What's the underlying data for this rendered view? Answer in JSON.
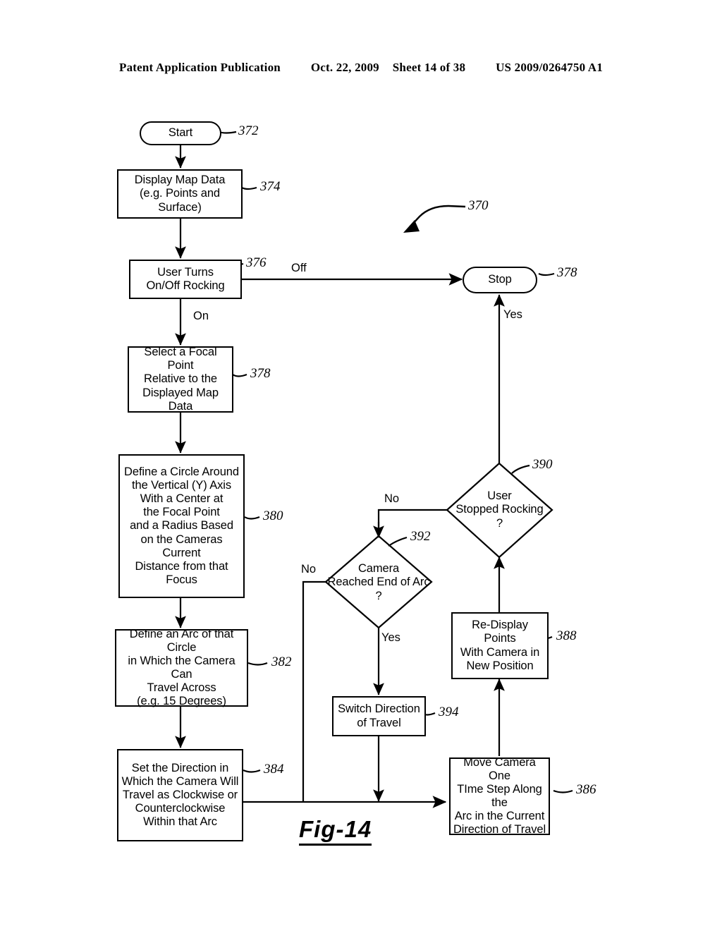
{
  "header": {
    "publication": "Patent Application Publication",
    "date": "Oct. 22, 2009",
    "sheet": "Sheet 14 of 38",
    "pub_number": "US 2009/0264750 A1"
  },
  "figure": {
    "caption": "Fig-14",
    "diagram_ref": "370",
    "nodes": [
      {
        "id": "start",
        "ref": "372",
        "type": "terminator",
        "text": "Start"
      },
      {
        "id": "display_map",
        "ref": "374",
        "type": "process",
        "text": "Display Map Data\n(e.g. Points and Surface)"
      },
      {
        "id": "toggle_rock",
        "ref": "376",
        "type": "process",
        "text": "User Turns\nOn/Off Rocking"
      },
      {
        "id": "stop",
        "ref": "378",
        "type": "terminator",
        "text": "Stop"
      },
      {
        "id": "focal_point",
        "ref": "378",
        "type": "process",
        "text": "Select a Focal Point\nRelative to the\nDisplayed Map Data"
      },
      {
        "id": "define_circle",
        "ref": "380",
        "type": "process",
        "text": "Define a Circle Around\nthe Vertical (Y) Axis\nWith a Center at\nthe Focal Point\nand a Radius Based\non the Cameras Current\nDistance from that Focus"
      },
      {
        "id": "define_arc",
        "ref": "382",
        "type": "process",
        "text": "Define an Arc of that Circle\nin Which the Camera Can\nTravel Across\n(e.g. 15 Degrees)"
      },
      {
        "id": "set_direction",
        "ref": "384",
        "type": "process",
        "text": "Set the Direction in\nWhich the Camera Will\nTravel as Clockwise or\nCounterclockwise\nWithin that Arc"
      },
      {
        "id": "move_camera",
        "ref": "386",
        "type": "process",
        "text": "Move Camera One\nTIme Step Along the\nArc in the Current\nDirection of Travel"
      },
      {
        "id": "redisplay",
        "ref": "388",
        "type": "process",
        "text": "Re-Display Points\nWith Camera in\nNew Position"
      },
      {
        "id": "user_stopped",
        "ref": "390",
        "type": "decision",
        "text": "User\nStopped Rocking\n?"
      },
      {
        "id": "end_of_arc",
        "ref": "392",
        "type": "decision",
        "text": "Camera\nReached End of Arc\n?"
      },
      {
        "id": "switch_dir",
        "ref": "394",
        "type": "process",
        "text": "Switch Direction\nof Travel"
      }
    ],
    "edge_labels": {
      "off": "Off",
      "on": "On",
      "yes_to_stop": "Yes",
      "no_from_user_stopped": "No",
      "no_from_end_of_arc": "No",
      "yes_from_end_of_arc": "Yes"
    },
    "node_text": {
      "start": "Start",
      "display_map_l1": "Display Map Data",
      "display_map_l2": "(e.g. Points and Surface)",
      "toggle_rock_l1": "User Turns",
      "toggle_rock_l2": "On/Off Rocking",
      "stop": "Stop",
      "focal_point_l1": "Select a Focal Point",
      "focal_point_l2": "Relative to the",
      "focal_point_l3": "Displayed Map Data",
      "define_circle_l1": "Define a Circle Around",
      "define_circle_l2": "the Vertical (Y) Axis",
      "define_circle_l3": "With a Center at",
      "define_circle_l4": "the Focal Point",
      "define_circle_l5": "and a Radius Based",
      "define_circle_l6": "on the Cameras Current",
      "define_circle_l7": "Distance from that Focus",
      "define_arc_l1": "Define an Arc of that Circle",
      "define_arc_l2": "in Which the Camera Can",
      "define_arc_l3": "Travel Across",
      "define_arc_l4": "(e.g. 15 Degrees)",
      "set_direction_l1": "Set the Direction in",
      "set_direction_l2": "Which the Camera Will",
      "set_direction_l3": "Travel as Clockwise or",
      "set_direction_l4": "Counterclockwise",
      "set_direction_l5": "Within that Arc",
      "move_camera_l1": "Move Camera One",
      "move_camera_l2": "TIme Step Along the",
      "move_camera_l3": "Arc in the Current",
      "move_camera_l4": "Direction of Travel",
      "redisplay_l1": "Re-Display Points",
      "redisplay_l2": "With Camera in",
      "redisplay_l3": "New Position",
      "user_stopped_l1": "User",
      "user_stopped_l2": "Stopped Rocking",
      "user_stopped_l3": "?",
      "end_of_arc_l1": "Camera",
      "end_of_arc_l2": "Reached End of Arc",
      "end_of_arc_l3": "?",
      "switch_dir_l1": "Switch Direction",
      "switch_dir_l2": "of Travel"
    },
    "refs": {
      "r370": "370",
      "r372": "372",
      "r374": "374",
      "r376": "376",
      "r378_stop": "378",
      "r378_focal": "378",
      "r380": "380",
      "r382": "382",
      "r384": "384",
      "r386": "386",
      "r388": "388",
      "r390": "390",
      "r392": "392",
      "r394": "394"
    }
  },
  "colors": {
    "ink": "#000000",
    "paper": "#ffffff"
  }
}
